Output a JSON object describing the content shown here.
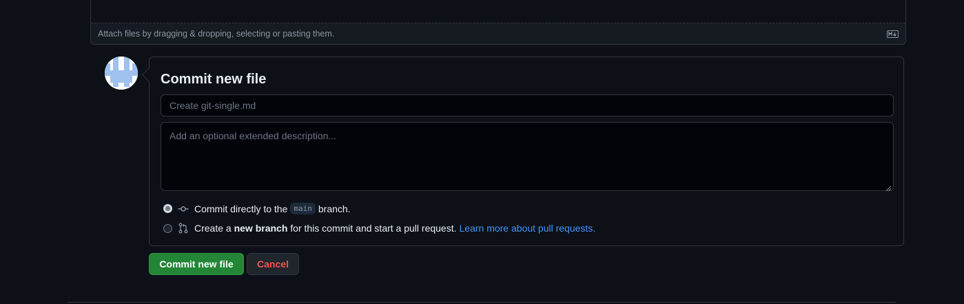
{
  "editor": {
    "attach_text": "Attach files by dragging & dropping, selecting or pasting them."
  },
  "commit": {
    "title": "Commit new file",
    "summary_placeholder": "Create git-single.md",
    "description_placeholder": "Add an optional extended description...",
    "option_direct": {
      "prefix": "Commit directly to the",
      "branch": "main",
      "suffix": "branch.",
      "selected": true
    },
    "option_new_branch": {
      "prefix": "Create a",
      "bold": "new branch",
      "suffix": "for this commit and start a pull request.",
      "link": "Learn more about pull requests.",
      "selected": false
    }
  },
  "buttons": {
    "commit_label": "Commit new file",
    "cancel_label": "Cancel"
  },
  "colors": {
    "background": "#0d1117",
    "border": "#30363d",
    "primary_button": "#238636",
    "danger_text": "#f85149",
    "link": "#4493f8"
  },
  "icons": {
    "markdown": "markdown-icon",
    "commit": "git-commit-icon",
    "pull_request": "git-pull-request-icon",
    "avatar": "identicon-avatar"
  }
}
